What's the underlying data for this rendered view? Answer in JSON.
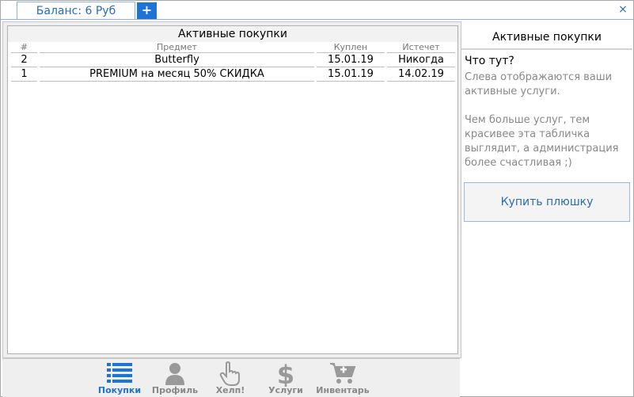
{
  "tabs": {
    "balance_label": "Баланс: 6 Руб",
    "add_label": "+",
    "close_label": "×"
  },
  "table": {
    "title": "Активные покупки",
    "columns": [
      "#",
      "Предмет",
      "Куплен",
      "Истечет"
    ],
    "rows": [
      [
        "2",
        "Butterfly",
        "15.01.19",
        "Никогда"
      ],
      [
        "1",
        "PREMIUM на месяц 50% СКИДКА",
        "15.01.19",
        "14.02.19"
      ]
    ]
  },
  "sidebar": {
    "title": "Активные покупки",
    "question": "Что тут?",
    "description": "Слева отображаются ваши активные услуги.\n\nЧем больше услуг, тем красивее эта табличка выглядит, а администрация более счастливая ;)",
    "buy_button": "Купить плюшку"
  },
  "nav": {
    "items": [
      {
        "label": "Покупки",
        "icon": "list-icon",
        "active": true
      },
      {
        "label": "Профиль",
        "icon": "user-icon",
        "active": false
      },
      {
        "label": "Хелп!",
        "icon": "hand-pointer-icon",
        "active": false
      },
      {
        "label": "Услуги",
        "icon": "dollar-icon",
        "active": false
      },
      {
        "label": "Инвентарь",
        "icon": "cart-plus-icon",
        "active": false
      }
    ]
  },
  "colors": {
    "accent": "#1e73d6",
    "inactive": "#888888",
    "icon_gray": "#999999"
  }
}
